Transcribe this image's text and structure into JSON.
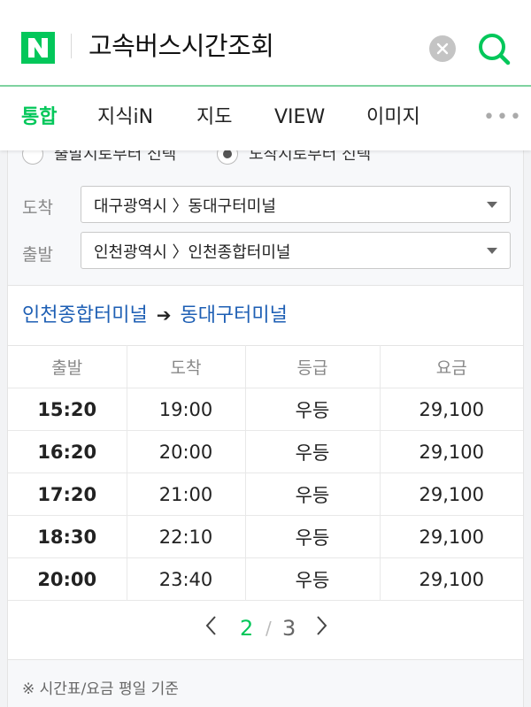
{
  "header": {
    "logo_icon": "naver-n-logo-icon",
    "query": "고속버스시간조회",
    "clear_icon": "clear-x-icon",
    "search_icon": "search-icon",
    "brand_color": "#03c75a"
  },
  "tabs": [
    {
      "label": "통합",
      "active": true
    },
    {
      "label": "지식iN",
      "active": false
    },
    {
      "label": "지도",
      "active": false
    },
    {
      "label": "VIEW",
      "active": false
    },
    {
      "label": "이미지",
      "active": false
    }
  ],
  "tabs_more": "•••",
  "filter": {
    "radio_departure": "출발지로부터 선택",
    "radio_arrival": "도착지로부터 선택",
    "arrival_label": "도착",
    "arrival_value": "대구광역시 〉동대구터미널",
    "departure_label": "출발",
    "departure_value": "인천광역시 〉인천종합터미널"
  },
  "route": {
    "from": "인천종합터미널",
    "arrow": "➔",
    "to": "동대구터미널"
  },
  "table": {
    "headers": [
      "출발",
      "도착",
      "등급",
      "요금"
    ],
    "rows": [
      [
        "15:20",
        "19:00",
        "우등",
        "29,100"
      ],
      [
        "16:20",
        "20:00",
        "우등",
        "29,100"
      ],
      [
        "17:20",
        "21:00",
        "우등",
        "29,100"
      ],
      [
        "18:30",
        "22:10",
        "우등",
        "29,100"
      ],
      [
        "20:00",
        "23:40",
        "우등",
        "29,100"
      ]
    ]
  },
  "pager": {
    "current": "2",
    "separator": "/",
    "total": "3"
  },
  "footnote": "※ 시간표/요금 평일 기준"
}
